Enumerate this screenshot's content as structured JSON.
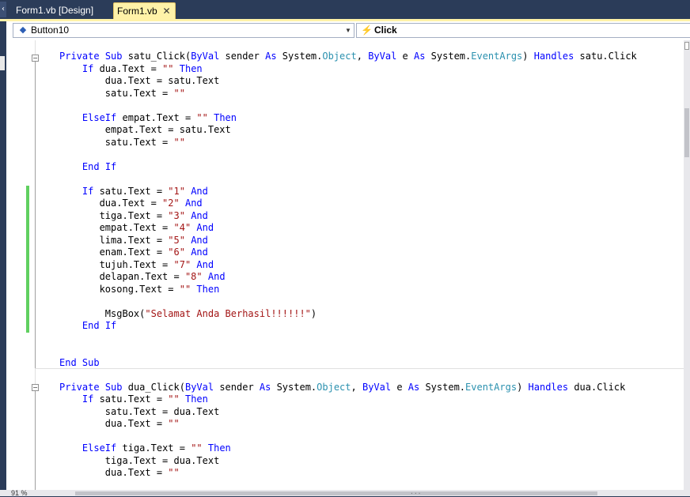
{
  "tabs": [
    {
      "label": "Form1.vb [Design]",
      "active": false
    },
    {
      "label": "Form1.vb",
      "active": true,
      "close_icon": "close-icon"
    }
  ],
  "navbar": {
    "object_combo": {
      "value": "Button10",
      "icon": "button-control-icon"
    },
    "event_combo": {
      "value": "Click",
      "icon": "lightning-event-icon"
    }
  },
  "status": {
    "zoom": "91 %"
  },
  "colors": {
    "keyword": "#0000ff",
    "type": "#2b91af",
    "string": "#a31515",
    "changed_line": "#60d060",
    "active_tab": "#fff2a8"
  },
  "code_lines": [
    [
      {
        "t": "Private",
        "c": "kw"
      },
      {
        "t": " "
      },
      {
        "t": "Sub",
        "c": "kw"
      },
      {
        "t": " satu_Click("
      },
      {
        "t": "ByVal",
        "c": "kw"
      },
      {
        "t": " sender "
      },
      {
        "t": "As",
        "c": "kw"
      },
      {
        "t": " System."
      },
      {
        "t": "Object",
        "c": "ty"
      },
      {
        "t": ", "
      },
      {
        "t": "ByVal",
        "c": "kw"
      },
      {
        "t": " e "
      },
      {
        "t": "As",
        "c": "kw"
      },
      {
        "t": " System."
      },
      {
        "t": "EventArgs",
        "c": "ty"
      },
      {
        "t": ") "
      },
      {
        "t": "Handles",
        "c": "kw"
      },
      {
        "t": " satu.Click"
      }
    ],
    [
      {
        "t": "    "
      },
      {
        "t": "If",
        "c": "kw"
      },
      {
        "t": " dua.Text = "
      },
      {
        "t": "\"\"",
        "c": "st"
      },
      {
        "t": " "
      },
      {
        "t": "Then",
        "c": "kw"
      }
    ],
    [
      {
        "t": "        dua.Text = satu.Text"
      }
    ],
    [
      {
        "t": "        satu.Text = "
      },
      {
        "t": "\"\"",
        "c": "st"
      }
    ],
    [],
    [
      {
        "t": "    "
      },
      {
        "t": "ElseIf",
        "c": "kw"
      },
      {
        "t": " empat.Text = "
      },
      {
        "t": "\"\"",
        "c": "st"
      },
      {
        "t": " "
      },
      {
        "t": "Then",
        "c": "kw"
      }
    ],
    [
      {
        "t": "        empat.Text = satu.Text"
      }
    ],
    [
      {
        "t": "        satu.Text = "
      },
      {
        "t": "\"\"",
        "c": "st"
      }
    ],
    [],
    [
      {
        "t": "    "
      },
      {
        "t": "End",
        "c": "kw"
      },
      {
        "t": " "
      },
      {
        "t": "If",
        "c": "kw"
      }
    ],
    [],
    [
      {
        "t": "    "
      },
      {
        "t": "If",
        "c": "kw"
      },
      {
        "t": " satu.Text = "
      },
      {
        "t": "\"1\"",
        "c": "st"
      },
      {
        "t": " "
      },
      {
        "t": "And",
        "c": "kw"
      }
    ],
    [
      {
        "t": "       dua.Text = "
      },
      {
        "t": "\"2\"",
        "c": "st"
      },
      {
        "t": " "
      },
      {
        "t": "And",
        "c": "kw"
      }
    ],
    [
      {
        "t": "       tiga.Text = "
      },
      {
        "t": "\"3\"",
        "c": "st"
      },
      {
        "t": " "
      },
      {
        "t": "And",
        "c": "kw"
      }
    ],
    [
      {
        "t": "       empat.Text = "
      },
      {
        "t": "\"4\"",
        "c": "st"
      },
      {
        "t": " "
      },
      {
        "t": "And",
        "c": "kw"
      }
    ],
    [
      {
        "t": "       lima.Text = "
      },
      {
        "t": "\"5\"",
        "c": "st"
      },
      {
        "t": " "
      },
      {
        "t": "And",
        "c": "kw"
      }
    ],
    [
      {
        "t": "       enam.Text = "
      },
      {
        "t": "\"6\"",
        "c": "st"
      },
      {
        "t": " "
      },
      {
        "t": "And",
        "c": "kw"
      }
    ],
    [
      {
        "t": "       tujuh.Text = "
      },
      {
        "t": "\"7\"",
        "c": "st"
      },
      {
        "t": " "
      },
      {
        "t": "And",
        "c": "kw"
      }
    ],
    [
      {
        "t": "       delapan.Text = "
      },
      {
        "t": "\"8\"",
        "c": "st"
      },
      {
        "t": " "
      },
      {
        "t": "And",
        "c": "kw"
      }
    ],
    [
      {
        "t": "       kosong.Text = "
      },
      {
        "t": "\"\"",
        "c": "st"
      },
      {
        "t": " "
      },
      {
        "t": "Then",
        "c": "kw"
      }
    ],
    [],
    [
      {
        "t": "        MsgBox("
      },
      {
        "t": "\"Selamat Anda Berhasil!!!!!!\"",
        "c": "st"
      },
      {
        "t": ")"
      }
    ],
    [
      {
        "t": "    "
      },
      {
        "t": "End",
        "c": "kw"
      },
      {
        "t": " "
      },
      {
        "t": "If",
        "c": "kw"
      }
    ],
    [],
    [],
    [
      {
        "t": "End",
        "c": "kw"
      },
      {
        "t": " "
      },
      {
        "t": "Sub",
        "c": "kw"
      }
    ],
    [],
    [
      {
        "t": "Private",
        "c": "kw"
      },
      {
        "t": " "
      },
      {
        "t": "Sub",
        "c": "kw"
      },
      {
        "t": " dua_Click("
      },
      {
        "t": "ByVal",
        "c": "kw"
      },
      {
        "t": " sender "
      },
      {
        "t": "As",
        "c": "kw"
      },
      {
        "t": " System."
      },
      {
        "t": "Object",
        "c": "ty"
      },
      {
        "t": ", "
      },
      {
        "t": "ByVal",
        "c": "kw"
      },
      {
        "t": " e "
      },
      {
        "t": "As",
        "c": "kw"
      },
      {
        "t": " System."
      },
      {
        "t": "EventArgs",
        "c": "ty"
      },
      {
        "t": ") "
      },
      {
        "t": "Handles",
        "c": "kw"
      },
      {
        "t": " dua.Click"
      }
    ],
    [
      {
        "t": "    "
      },
      {
        "t": "If",
        "c": "kw"
      },
      {
        "t": " satu.Text = "
      },
      {
        "t": "\"\"",
        "c": "st"
      },
      {
        "t": " "
      },
      {
        "t": "Then",
        "c": "kw"
      }
    ],
    [
      {
        "t": "        satu.Text = dua.Text"
      }
    ],
    [
      {
        "t": "        dua.Text = "
      },
      {
        "t": "\"\"",
        "c": "st"
      }
    ],
    [],
    [
      {
        "t": "    "
      },
      {
        "t": "ElseIf",
        "c": "kw"
      },
      {
        "t": " tiga.Text = "
      },
      {
        "t": "\"\"",
        "c": "st"
      },
      {
        "t": " "
      },
      {
        "t": "Then",
        "c": "kw"
      }
    ],
    [
      {
        "t": "        tiga.Text = dua.Text"
      }
    ],
    [
      {
        "t": "        dua.Text = "
      },
      {
        "t": "\"\"",
        "c": "st"
      }
    ]
  ]
}
